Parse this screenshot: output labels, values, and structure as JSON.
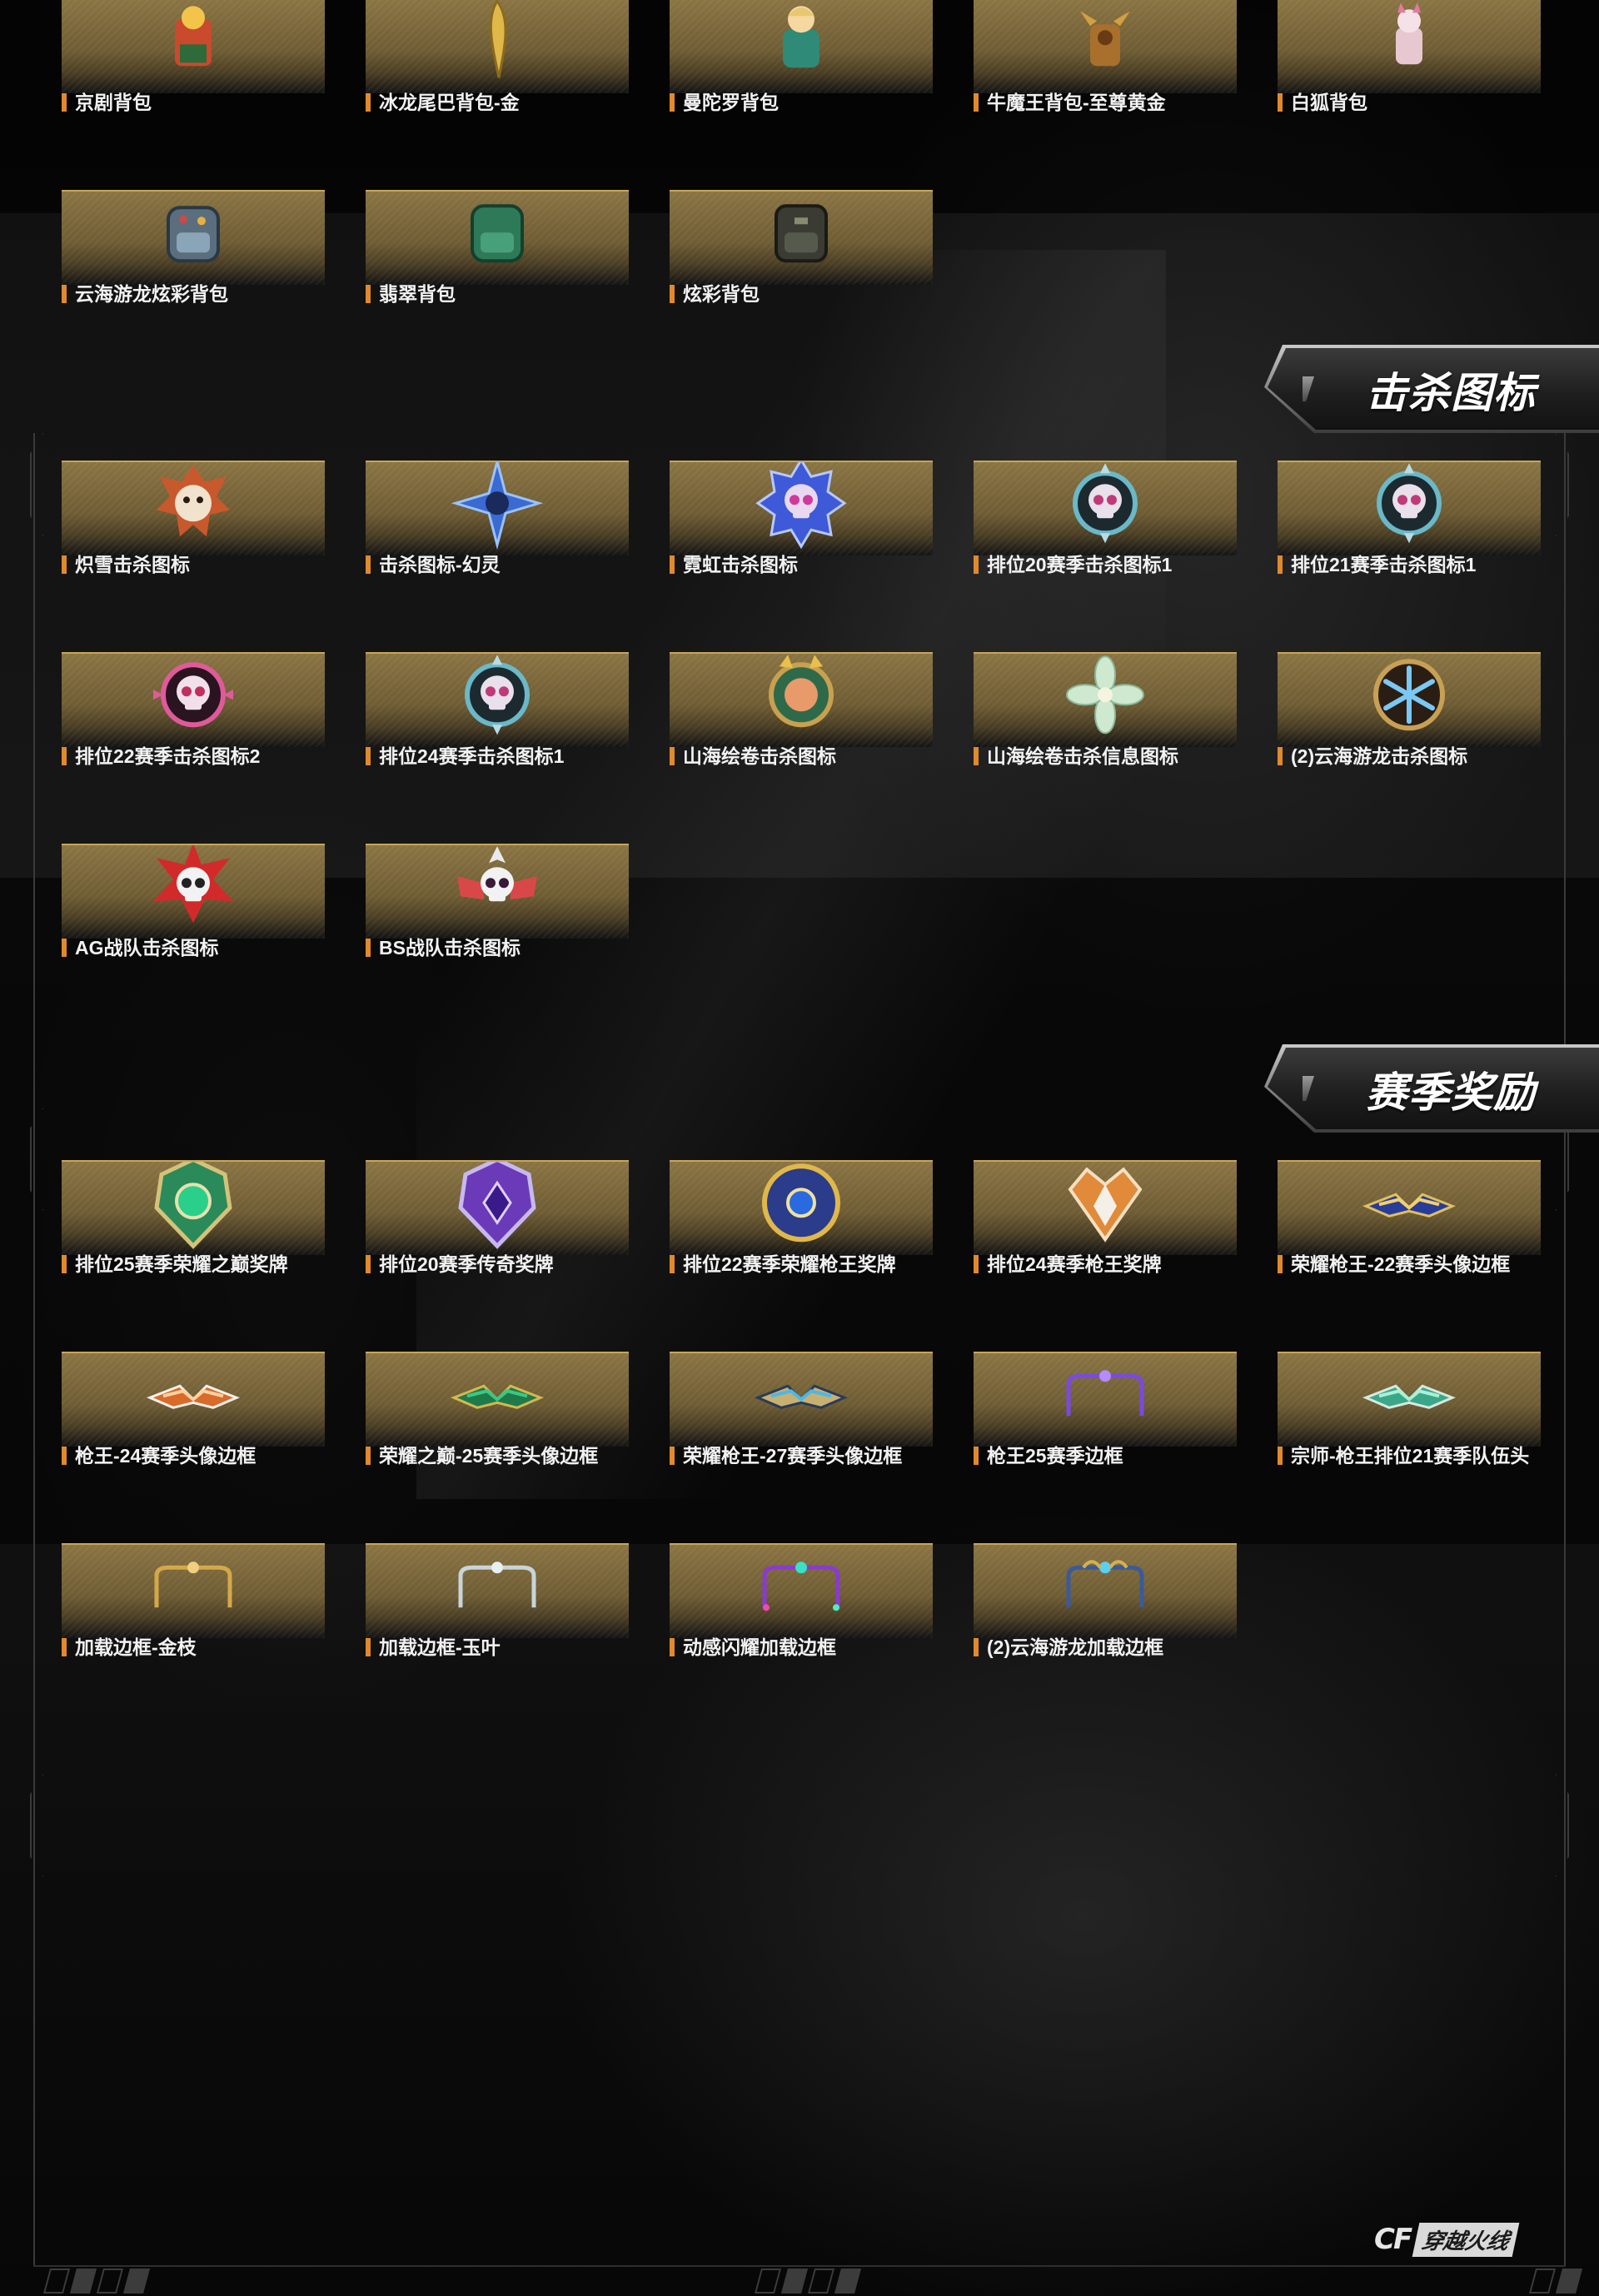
{
  "sections": [
    {
      "id": "backpacks",
      "title": "",
      "items": [
        {
          "label": "京剧背包",
          "icon": "opera-figure-backpack-icon"
        },
        {
          "label": "冰龙尾巴背包-金",
          "icon": "golden-dragon-tail-icon"
        },
        {
          "label": "曼陀罗背包",
          "icon": "doll-backpack-icon"
        },
        {
          "label": "牛魔王背包-至尊黄金",
          "icon": "bull-demon-backpack-icon"
        },
        {
          "label": "白狐背包",
          "icon": "white-fox-backpack-icon"
        },
        {
          "label": "云海游龙炫彩背包",
          "icon": "colorful-backpack-icon"
        },
        {
          "label": "翡翠背包",
          "icon": "jade-backpack-icon"
        },
        {
          "label": "炫彩背包",
          "icon": "dark-backpack-icon"
        }
      ]
    },
    {
      "id": "kill-icons",
      "title": "击杀图标",
      "items": [
        {
          "label": "炽雪击杀图标",
          "icon": "beast-kill-emblem-icon"
        },
        {
          "label": "击杀图标-幻灵",
          "icon": "blue-blade-kill-emblem-icon"
        },
        {
          "label": "霓虹击杀图标",
          "icon": "neon-skull-kill-emblem-icon"
        },
        {
          "label": "排位20赛季击杀图标1",
          "icon": "skull-kill-emblem-icon"
        },
        {
          "label": "排位21赛季击杀图标1",
          "icon": "skull-kill-emblem-icon"
        },
        {
          "label": "排位22赛季击杀图标2",
          "icon": "pink-skull-kill-emblem-icon"
        },
        {
          "label": "排位24赛季击杀图标1",
          "icon": "skull-kill-emblem-icon"
        },
        {
          "label": "山海绘卷击杀图标",
          "icon": "scroll-kill-emblem-icon"
        },
        {
          "label": "山海绘卷击杀信息图标",
          "icon": "flower-kill-emblem-icon"
        },
        {
          "label": "(2)云海游龙击杀图标",
          "icon": "snowflake-kill-emblem-icon"
        },
        {
          "label": "AG战队击杀图标",
          "icon": "red-skull-kill-emblem-icon"
        },
        {
          "label": "BS战队击杀图标",
          "icon": "winged-skull-kill-emblem-icon"
        }
      ]
    },
    {
      "id": "season-rewards",
      "title": "赛季奖励",
      "items": [
        {
          "label": "排位25赛季荣耀之巅奖牌",
          "icon": "green-medal-icon"
        },
        {
          "label": "排位20赛季传奇奖牌",
          "icon": "purple-medal-icon"
        },
        {
          "label": "排位22赛季荣耀枪王奖牌",
          "icon": "blue-gold-medal-icon"
        },
        {
          "label": "排位24赛季枪王奖牌",
          "icon": "orange-medal-icon"
        },
        {
          "label": "荣耀枪王-22赛季头像边框",
          "icon": "winged-frame-blue-icon"
        },
        {
          "label": "枪王-24赛季头像边框",
          "icon": "winged-frame-orange-icon"
        },
        {
          "label": "荣耀之巅-25赛季头像边框",
          "icon": "winged-frame-green-icon"
        },
        {
          "label": "荣耀枪王-27赛季头像边框",
          "icon": "winged-frame-teal-icon"
        },
        {
          "label": "枪王25赛季边框",
          "icon": "purple-border-frame-icon"
        },
        {
          "label": "宗师-枪王排位21赛季队伍头",
          "icon": "winged-frame-jade-icon"
        },
        {
          "label": "加载边框-金枝",
          "icon": "gold-branch-frame-icon"
        },
        {
          "label": "加载边框-玉叶",
          "icon": "jade-leaf-frame-icon"
        },
        {
          "label": "动感闪耀加载边框",
          "icon": "sparkle-frame-icon"
        },
        {
          "label": "(2)云海游龙加载边框",
          "icon": "dragon-cloud-frame-icon"
        }
      ]
    }
  ],
  "footer": {
    "logo_mark": "CF",
    "logo_text": "穿越火线"
  },
  "colors": {
    "card_gold": "#8a7443",
    "card_border": "#c7a657",
    "label_marker": "#e08a2c",
    "label_text": "#f2f2f2"
  }
}
